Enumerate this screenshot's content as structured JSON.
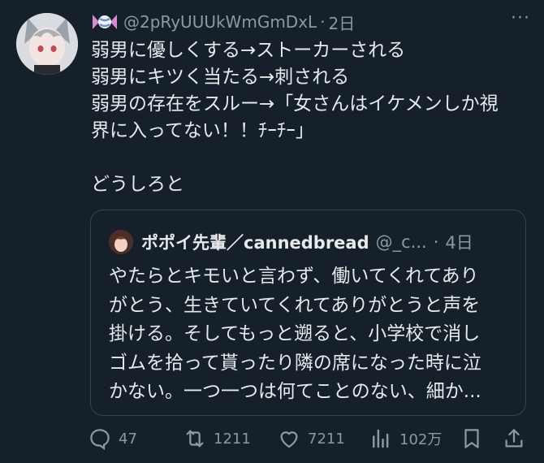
{
  "tweet": {
    "handle": "@2pRyUUUkWmGmDxL",
    "separator": "·",
    "time": "2日",
    "more_label": "···",
    "body_lines": [
      "弱男に優しくする→ストーカーされる",
      "弱男にキツく当たる→刺される",
      "弱男の存在をスルー→「女さんはイケメンしか視",
      "界に入ってない！！ﾁｰﾁｰ」",
      "",
      "どうしろと"
    ]
  },
  "quote": {
    "author_name": "ポポイ先輩／cannedbread",
    "handle": "@_c...",
    "separator": "·",
    "time": "4日",
    "text_lines": [
      "やたらとキモいと言わず、働いてくれてあり",
      "がとう、生きていてくれてありがとうと声を",
      "掛ける。そしてもっと遡ると、小学校で消し",
      "ゴムを拾って貰ったり隣の席になった時に泣",
      "かない。一つ一つは何てことのない、細か..."
    ]
  },
  "actions": {
    "reply_count": "47",
    "retweet_count": "1211",
    "like_count": "7211",
    "view_count": "102万"
  },
  "icons": {
    "header_emoji": "candy-icon",
    "reply": "reply-icon",
    "retweet": "retweet-icon",
    "like": "heart-icon",
    "views": "views-icon",
    "bookmark": "bookmark-icon",
    "share": "share-icon"
  },
  "colors": {
    "background": "#15202b",
    "text": "#e7e9ea",
    "secondary": "#8b98a5",
    "border": "#38444d"
  }
}
